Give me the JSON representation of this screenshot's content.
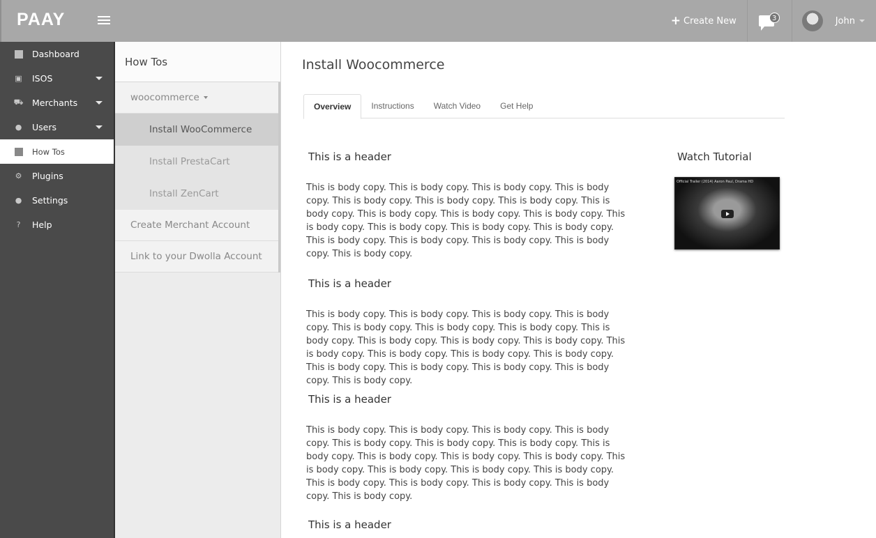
{
  "topbar": {
    "logo": "PAAY",
    "create_new": "Create New",
    "messages_count": "3",
    "user_name": "John"
  },
  "sidebar": {
    "items": [
      {
        "label": "Dashboard",
        "icon": "dashboard-square-icon"
      },
      {
        "label": "ISOS",
        "icon": "money-icon"
      },
      {
        "label": "Merchants",
        "icon": "cart-icon"
      },
      {
        "label": "Users",
        "icon": "user-icon"
      },
      {
        "label": "How Tos",
        "icon": "book-square-icon"
      },
      {
        "label": "Plugins",
        "icon": "cogs-icon"
      },
      {
        "label": "Settings",
        "icon": "user-icon"
      },
      {
        "label": "Help",
        "icon": "question-icon"
      }
    ]
  },
  "subpanel": {
    "title": "How Tos",
    "group": "woocommerce",
    "children": [
      "Install WooCommerce",
      "Install PrestaCart",
      "Install ZenCart"
    ],
    "links": [
      "Create Merchant Account",
      "Link to your Dwolla Account"
    ]
  },
  "main": {
    "title": "Install Woocommerce",
    "tabs": [
      "Overview",
      "Instructions",
      "Watch Video",
      "Get Help"
    ],
    "sections": [
      {
        "header": "This is a header",
        "body": "This is body copy. This is body copy. This is body copy. This is body copy. This is body copy. This is body copy. This is body copy. This is body copy. This is body copy. This is body copy. This is body copy. This is body copy. This is body copy. This is body copy. This is body copy. This is body copy. This is body copy. This is body copy. This is body copy. This is body copy."
      },
      {
        "header": "This is a header",
        "body": "This is body copy. This is body copy. This is body copy. This is body copy. This is body copy. This is body copy. This is body copy. This is body copy. This is body copy. This is body copy. This is body copy. This is body copy. This is body copy. This is body copy. This is body copy. This is body copy. This is body copy. This is body copy. This is body copy. This is body copy."
      },
      {
        "header": "This is a header",
        "body": "This is body copy. This is body copy. This is body copy. This is body copy. This is body copy. This is body copy. This is body copy. This is body copy. This is body copy. This is body copy. This is body copy. This is body copy. This is body copy. This is body copy. This is body copy. This is body copy. This is body copy. This is body copy. This is body copy. This is body copy."
      },
      {
        "header": "This is a header",
        "body": ""
      }
    ],
    "tutorial": {
      "title": "Watch Tutorial",
      "video_caption": "Official Trailer (2014) Aaron Paul, Drama HD"
    }
  }
}
